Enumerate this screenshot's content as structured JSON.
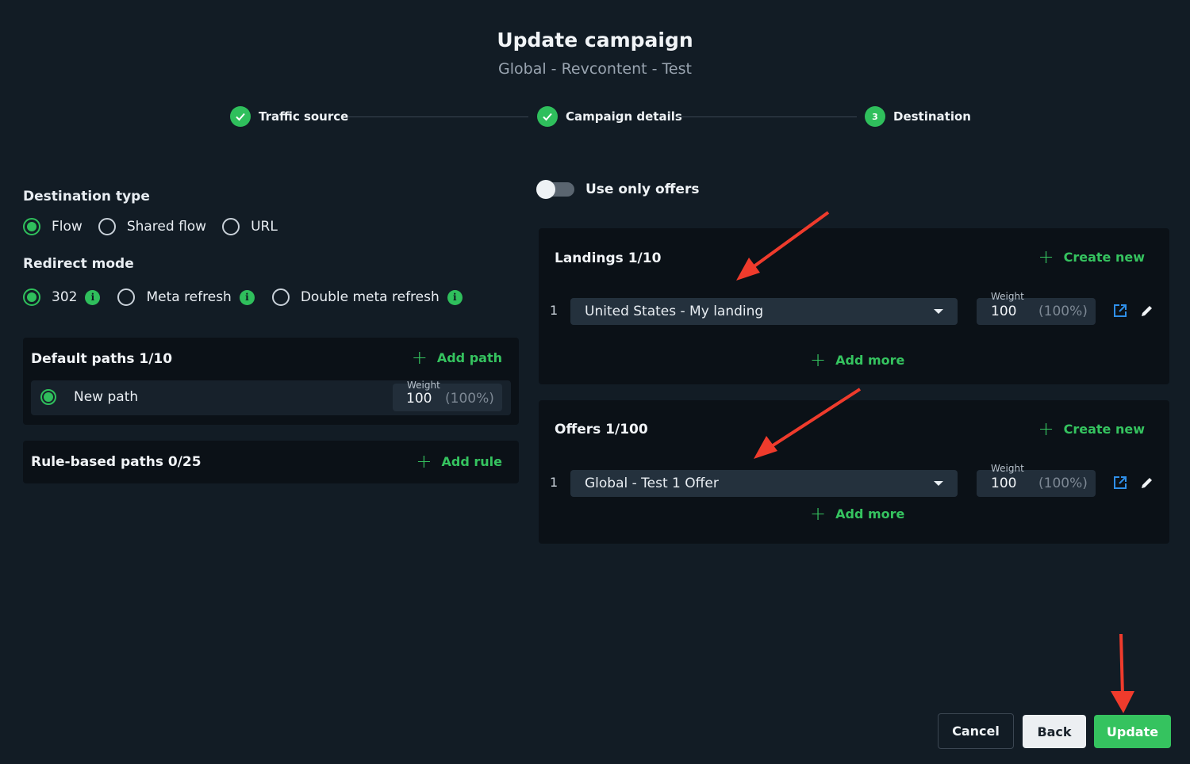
{
  "header": {
    "title": "Update campaign",
    "subtitle": "Global - Revcontent - Test"
  },
  "stepper": [
    {
      "label": "Traffic source",
      "state": "done"
    },
    {
      "label": "Campaign details",
      "state": "done"
    },
    {
      "label": "Destination",
      "state": "current",
      "number": "3"
    }
  ],
  "destination_type": {
    "label": "Destination type",
    "options": [
      "Flow",
      "Shared flow",
      "URL"
    ],
    "selected": "Flow"
  },
  "redirect_mode": {
    "label": "Redirect mode",
    "options": [
      "302",
      "Meta refresh",
      "Double meta refresh"
    ],
    "selected": "302"
  },
  "default_paths": {
    "title": "Default paths 1/10",
    "action": "Add path",
    "paths": [
      {
        "name": "New path",
        "weight_label": "Weight",
        "weight": "100",
        "percent": "(100%)"
      }
    ]
  },
  "rule_paths": {
    "title": "Rule-based paths 0/25",
    "action": "Add rule"
  },
  "use_only_offers": {
    "label": "Use only offers",
    "enabled": false
  },
  "landings": {
    "title": "Landings 1/10",
    "create": "Create new",
    "add_more": "Add more",
    "items": [
      {
        "index": "1",
        "value": "United States - My landing",
        "weight_label": "Weight",
        "weight": "100",
        "percent": "(100%)"
      }
    ]
  },
  "offers": {
    "title": "Offers 1/100",
    "create": "Create new",
    "add_more": "Add more",
    "items": [
      {
        "index": "1",
        "value": "Global - Test 1 Offer",
        "weight_label": "Weight",
        "weight": "100",
        "percent": "(100%)"
      }
    ]
  },
  "footer": {
    "cancel": "Cancel",
    "back": "Back",
    "update": "Update"
  },
  "colors": {
    "accent": "#35c35f",
    "background": "#121c25",
    "panel": "#0b1117",
    "annotation_arrow": "#ef3b2c"
  }
}
